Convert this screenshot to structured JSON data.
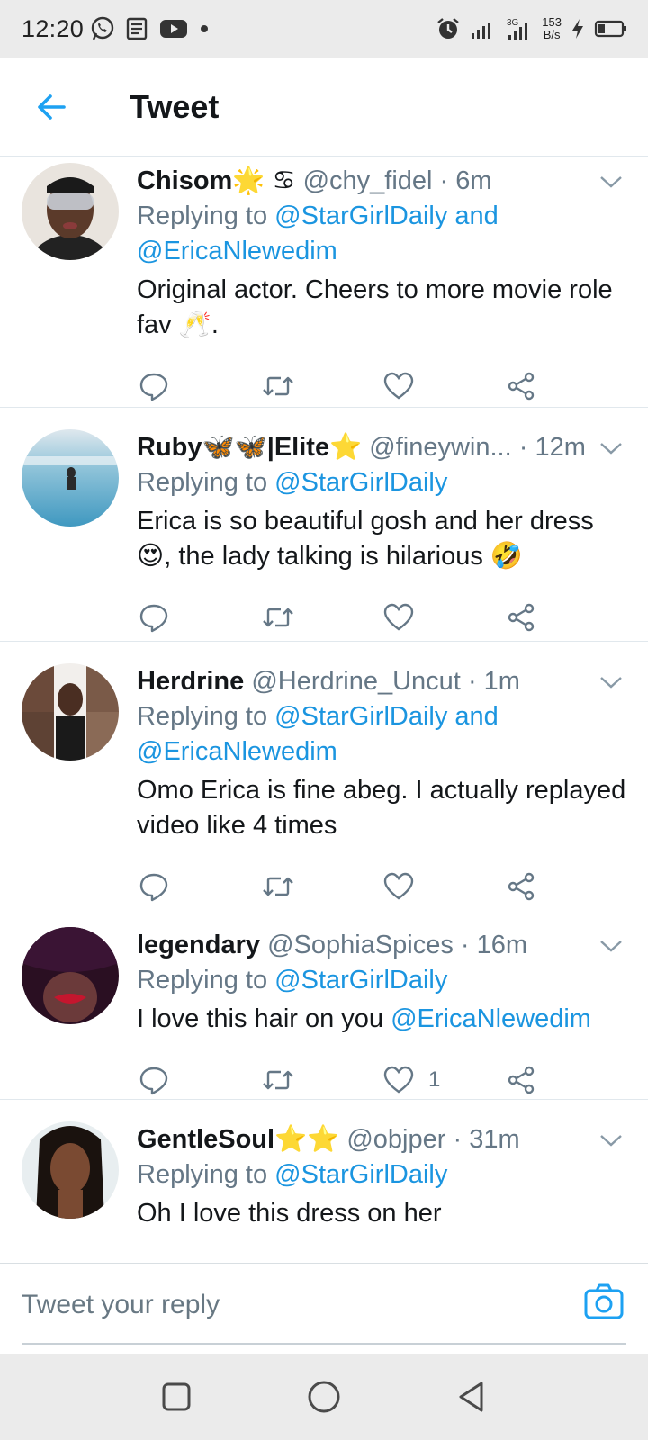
{
  "status_bar": {
    "time": "12:20",
    "speed_value": "153",
    "speed_unit": "B/s",
    "icons": [
      "whatsapp-icon",
      "news-icon",
      "youtube-icon",
      "dot-icon",
      "alarm-icon",
      "signal-icon",
      "signal-4g-icon",
      "charging-icon",
      "battery-icon"
    ]
  },
  "header": {
    "title": "Tweet",
    "back_icon": "arrow-left-icon"
  },
  "colors": {
    "accent": "#1da1f2",
    "mention": "#1b95e0",
    "secondary_text": "#657786",
    "primary_text": "#14171a"
  },
  "tweets": [
    {
      "name": "Chisom",
      "name_emojis": "🌟 ♋",
      "handle": "@chy_fidel",
      "time": "6m",
      "replying_to": "Replying to",
      "mentions": "@StarGirlDaily and @EricaNlewedim",
      "text": "Original actor. Cheers to more movie role fav 🥂.",
      "like_count": ""
    },
    {
      "name": "Ruby🦋🦋|Elite",
      "name_emojis": "⭐",
      "handle": "@fineywin...",
      "time": "12m",
      "replying_to": "Replying to",
      "mentions": "@StarGirlDaily",
      "text": "Erica is so beautiful gosh and her dress 😍, the lady talking is hilarious 🤣",
      "like_count": ""
    },
    {
      "name": "Herdrine",
      "name_emojis": "",
      "handle": "@Herdrine_Uncut",
      "time": "1m",
      "replying_to": "Replying to",
      "mentions": "@StarGirlDaily and @EricaNlewedim",
      "text": "Omo Erica is fine abeg. I actually replayed video like 4 times",
      "like_count": ""
    },
    {
      "name": "legendary",
      "name_emojis": "",
      "handle": "@SophiaSpices",
      "time": "16m",
      "replying_to": "Replying to",
      "mentions": "@StarGirlDaily",
      "text": "I love this hair on you",
      "text_mention": "@EricaNlewedim",
      "like_count": "1"
    },
    {
      "name": "GentleSoul",
      "name_emojis": "⭐⭐",
      "handle": "@objper",
      "time": "31m",
      "replying_to": "Replying to",
      "mentions": "@StarGirlDaily",
      "text": "Oh I love this dress on her",
      "like_count": ""
    }
  ],
  "reply_bar": {
    "placeholder": "Tweet your reply",
    "camera_icon": "camera-icon"
  },
  "nav_bar": {
    "buttons": [
      "recents-square-icon",
      "home-circle-icon",
      "back-triangle-icon"
    ]
  }
}
